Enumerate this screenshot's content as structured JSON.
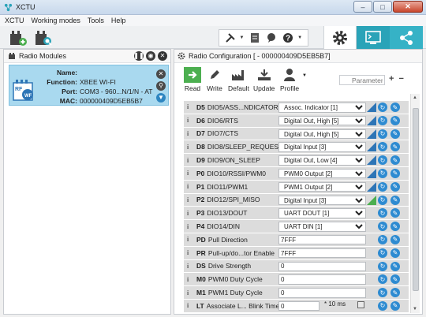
{
  "window": {
    "title": "XCTU",
    "min": "–",
    "max": "□",
    "close": "✕"
  },
  "menu": [
    "XCTU",
    "Working modes",
    "Tools",
    "Help"
  ],
  "radio_modules": {
    "title": "Radio Modules",
    "card": {
      "name_label": "Name:",
      "name_value": "",
      "function_label": "Function:",
      "function_value": "XBEE WI-FI",
      "port_label": "Port:",
      "port_value": "COM3 - 960...N/1/N - AT",
      "mac_label": "MAC:",
      "mac_value": "000000409D5EB5B7"
    }
  },
  "radio_config": {
    "title": "Radio Configuration [ - 000000409D5EB5B7]",
    "buttons": {
      "read": "Read",
      "write": "Write",
      "default": "Default",
      "update": "Update",
      "profile": "Profile"
    },
    "search_placeholder": "Parameter",
    "rows": [
      {
        "code": "D5",
        "name": "DIO5/ASS...NDICATOR",
        "value": "Assoc. Indicator [1]"
      },
      {
        "code": "D6",
        "name": "DIO6/RTS",
        "value": "Digital Out, High [5]"
      },
      {
        "code": "D7",
        "name": "DIO7/CTS",
        "value": "Digital Out, High [5]"
      },
      {
        "code": "D8",
        "name": "DIO8/SLEEP_REQUEST",
        "value": "Digital Input [3]"
      },
      {
        "code": "D9",
        "name": "DIO9/ON_SLEEP",
        "value": "Digital Out, Low [4]"
      },
      {
        "code": "P0",
        "name": "DIO10/RSSI/PWM0",
        "value": "PWM0 Output [2]"
      },
      {
        "code": "P1",
        "name": "DIO11/PWM1",
        "value": "PWM1 Output [2]"
      },
      {
        "code": "P2",
        "name": "DIO12/SPI_MISO",
        "value": "Digital Input [3]"
      },
      {
        "code": "P3",
        "name": "DIO13/DOUT",
        "value": "UART DOUT [1]"
      },
      {
        "code": "P4",
        "name": "DIO14/DIN",
        "value": "UART DIN [1]"
      },
      {
        "code": "PD",
        "name": "Pull Direction",
        "value": "7FFF"
      },
      {
        "code": "PR",
        "name": "Pull-up/do...tor Enable",
        "value": "7FFF"
      },
      {
        "code": "DS",
        "name": "Drive Strength",
        "value": "0"
      },
      {
        "code": "M0",
        "name": "PWM0 Duty Cycle",
        "value": "0"
      },
      {
        "code": "M1",
        "name": "PWM1 Duty Cycle",
        "value": "0"
      },
      {
        "code": "LT",
        "name": "Associate L... Blink Time",
        "value": "0",
        "unit": "* 10 ms"
      }
    ]
  },
  "colors": {
    "accent": "#2e8bd1",
    "selected_card": "#a9d9ef",
    "teal_tab": "#2aa3b8"
  }
}
